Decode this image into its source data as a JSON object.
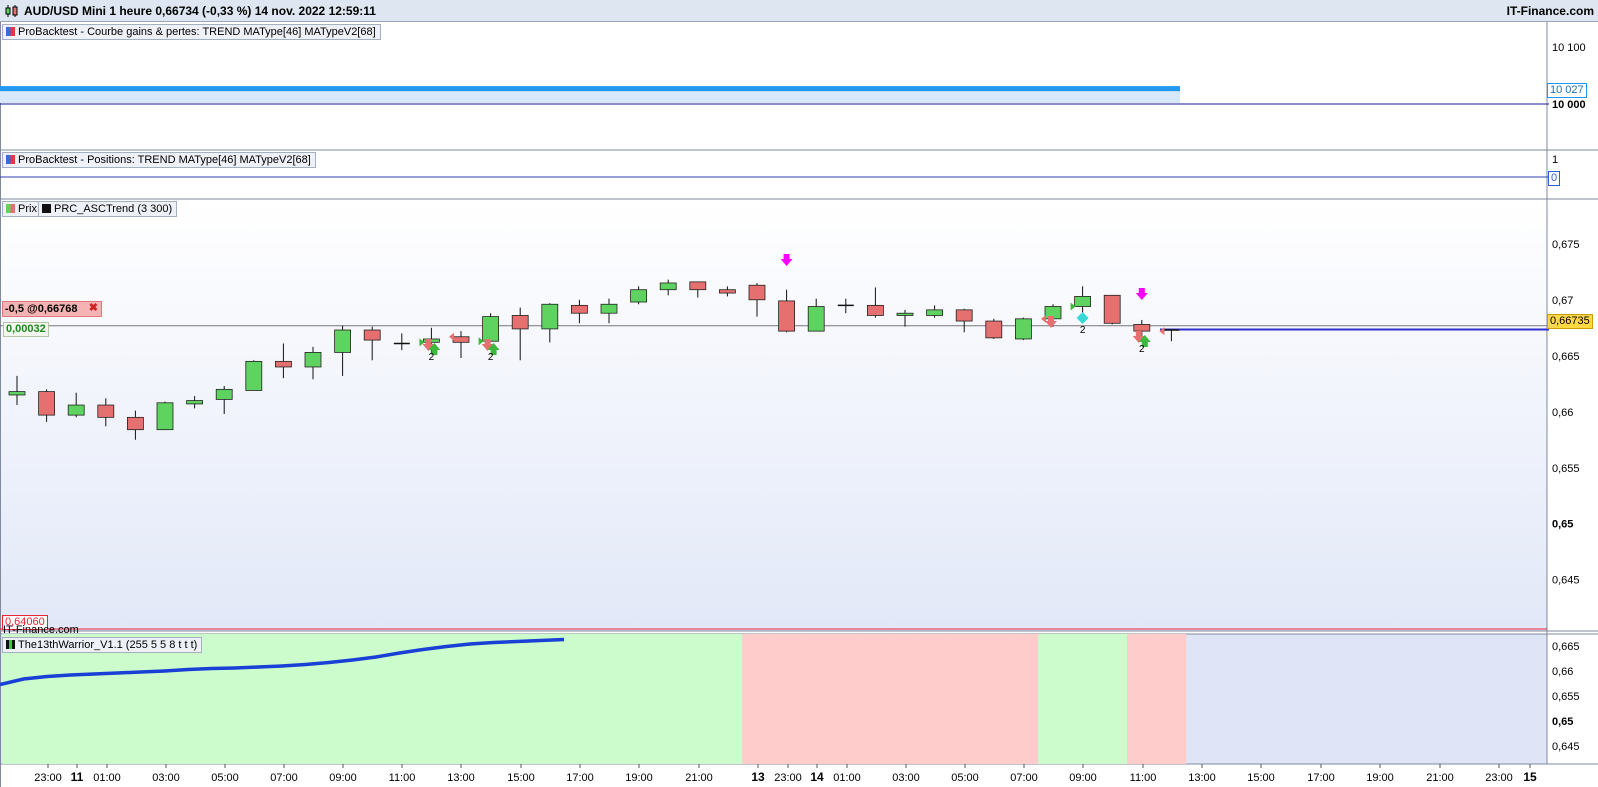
{
  "header": {
    "title": "AUD/USD Mini 1 heure 0,66734 (-0,33 %) 14 nov. 2022 12:59:11",
    "brand": "IT-Finance.com",
    "logo_icon": "candlestick-icon"
  },
  "panels": {
    "equity": {
      "label": "ProBacktest - Courbe gains & pertes: TREND MAType[46] MATypeV2[68]",
      "y_ticks": [
        "10 100",
        "10 000"
      ],
      "last_value_tag": "10 027",
      "baseline": 10000,
      "equity_value": 10027,
      "line_color": "#2196f3"
    },
    "positions": {
      "label": "ProBacktest - Positions: TREND MAType[46] MATypeV2[68]",
      "y_ticks": [
        "1"
      ],
      "last_value_tag": "0"
    },
    "price": {
      "legend_prix": "Prix",
      "legend_indicator": "PRC_ASCTrend (3 300)",
      "y_ticks": [
        "0,675",
        "0,67",
        "0,665",
        "0,66",
        "0,655",
        "0,65",
        "0,645"
      ],
      "position_label": "-0,5 @0,66768",
      "pnl_label": "0,00032",
      "close_icon": "close-icon",
      "low_label": "0,64060",
      "watermark": "IT-Finance.com",
      "current_price_tag": "0,66735",
      "signal_count_label": "2",
      "up_color": "#5fd35f",
      "down_color": "#e66f6f",
      "signal_color": "#ff00ff"
    },
    "warrior": {
      "label": "The13thWarrior_V1.1 (255 5 5 8 t t t)",
      "y_ticks": [
        "0,665",
        "0,66",
        "0,655",
        "0,65",
        "0,645"
      ],
      "line_color": "#1a3fd6",
      "bull_color": "#ccfccc",
      "bear_color": "#ffcccc"
    }
  },
  "x_axis": {
    "labels": [
      "23:00",
      "11",
      "01:00",
      "03:00",
      "05:00",
      "07:00",
      "09:00",
      "11:00",
      "13:00",
      "15:00",
      "17:00",
      "19:00",
      "21:00",
      "13",
      "23:00",
      "14",
      "01:00",
      "03:00",
      "05:00",
      "07:00",
      "09:00",
      "11:00",
      "13:00",
      "15:00",
      "17:00",
      "19:00",
      "21:00",
      "23:00",
      "15"
    ]
  },
  "chart_data": {
    "type": "candlestick",
    "title": "AUD/USD Mini 1 heure",
    "ylim": [
      0.6406,
      0.679
    ],
    "candles": [
      {
        "t": "22:00",
        "o": 0.6615,
        "h": 0.6632,
        "l": 0.6606,
        "c": 0.6618
      },
      {
        "t": "23:00",
        "o": 0.6618,
        "h": 0.662,
        "l": 0.6591,
        "c": 0.6597
      },
      {
        "t": "00:00",
        "o": 0.6597,
        "h": 0.6617,
        "l": 0.6595,
        "c": 0.6606
      },
      {
        "t": "01:00",
        "o": 0.6606,
        "h": 0.6612,
        "l": 0.6587,
        "c": 0.6595
      },
      {
        "t": "02:00",
        "o": 0.6595,
        "h": 0.6601,
        "l": 0.6575,
        "c": 0.6584
      },
      {
        "t": "03:00",
        "o": 0.6584,
        "h": 0.6609,
        "l": 0.6584,
        "c": 0.6608
      },
      {
        "t": "04:00",
        "o": 0.6607,
        "h": 0.6614,
        "l": 0.6603,
        "c": 0.661
      },
      {
        "t": "05:00",
        "o": 0.6611,
        "h": 0.6623,
        "l": 0.6598,
        "c": 0.662
      },
      {
        "t": "06:00",
        "o": 0.6619,
        "h": 0.6646,
        "l": 0.6619,
        "c": 0.6645
      },
      {
        "t": "07:00",
        "o": 0.6645,
        "h": 0.6661,
        "l": 0.663,
        "c": 0.664
      },
      {
        "t": "08:00",
        "o": 0.664,
        "h": 0.6658,
        "l": 0.6629,
        "c": 0.6653
      },
      {
        "t": "09:00",
        "o": 0.6653,
        "h": 0.6677,
        "l": 0.6632,
        "c": 0.6673
      },
      {
        "t": "10:00",
        "o": 0.6673,
        "h": 0.6676,
        "l": 0.6646,
        "c": 0.6664
      },
      {
        "t": "11:00",
        "o": 0.6661,
        "h": 0.667,
        "l": 0.6655,
        "c": 0.6661
      },
      {
        "t": "12:00",
        "o": 0.6662,
        "h": 0.6675,
        "l": 0.6652,
        "c": 0.6665
      },
      {
        "t": "13:00",
        "o": 0.6667,
        "h": 0.6672,
        "l": 0.6648,
        "c": 0.6662
      },
      {
        "t": "14:00",
        "o": 0.6663,
        "h": 0.6688,
        "l": 0.6663,
        "c": 0.6685
      },
      {
        "t": "15:00",
        "o": 0.6686,
        "h": 0.6693,
        "l": 0.6646,
        "c": 0.6674
      },
      {
        "t": "16:00",
        "o": 0.6674,
        "h": 0.6697,
        "l": 0.6662,
        "c": 0.6696
      },
      {
        "t": "17:00",
        "o": 0.6695,
        "h": 0.67,
        "l": 0.6679,
        "c": 0.6688
      },
      {
        "t": "18:00",
        "o": 0.6688,
        "h": 0.6701,
        "l": 0.6679,
        "c": 0.6696
      },
      {
        "t": "19:00",
        "o": 0.6698,
        "h": 0.6712,
        "l": 0.6696,
        "c": 0.6709
      },
      {
        "t": "20:00",
        "o": 0.6709,
        "h": 0.6718,
        "l": 0.6704,
        "c": 0.6715
      },
      {
        "t": "21:00",
        "o": 0.6716,
        "h": 0.6716,
        "l": 0.6702,
        "c": 0.6709
      },
      {
        "t": "22:00",
        "o": 0.6709,
        "h": 0.6712,
        "l": 0.6703,
        "c": 0.6706
      },
      {
        "t": "22:00",
        "o": 0.6713,
        "h": 0.6715,
        "l": 0.6685,
        "c": 0.67
      },
      {
        "t": "23:00",
        "o": 0.6699,
        "h": 0.6709,
        "l": 0.6671,
        "c": 0.6672
      },
      {
        "t": "00:00",
        "o": 0.6672,
        "h": 0.6701,
        "l": 0.6672,
        "c": 0.6694
      },
      {
        "t": "01:00",
        "o": 0.6695,
        "h": 0.6701,
        "l": 0.6688,
        "c": 0.6695
      },
      {
        "t": "02:00",
        "o": 0.6695,
        "h": 0.6711,
        "l": 0.6684,
        "c": 0.6686
      },
      {
        "t": "03:00",
        "o": 0.6686,
        "h": 0.6691,
        "l": 0.6676,
        "c": 0.6688
      },
      {
        "t": "04:00",
        "o": 0.6686,
        "h": 0.6695,
        "l": 0.6684,
        "c": 0.6691
      },
      {
        "t": "05:00",
        "o": 0.6691,
        "h": 0.6692,
        "l": 0.6671,
        "c": 0.6681
      },
      {
        "t": "06:00",
        "o": 0.6681,
        "h": 0.6683,
        "l": 0.6665,
        "c": 0.6666
      },
      {
        "t": "07:00",
        "o": 0.6665,
        "h": 0.6684,
        "l": 0.6664,
        "c": 0.6683
      },
      {
        "t": "08:00",
        "o": 0.6683,
        "h": 0.6696,
        "l": 0.6676,
        "c": 0.6694
      },
      {
        "t": "09:00",
        "o": 0.6694,
        "h": 0.6712,
        "l": 0.6684,
        "c": 0.6703
      },
      {
        "t": "10:00",
        "o": 0.6704,
        "h": 0.6704,
        "l": 0.6678,
        "c": 0.6679
      },
      {
        "t": "11:00",
        "o": 0.6678,
        "h": 0.6682,
        "l": 0.6666,
        "c": 0.6672
      },
      {
        "t": "12:00",
        "o": 0.6672,
        "h": 0.6673,
        "l": 0.6663,
        "c": 0.6673
      }
    ],
    "equity_curve": {
      "baseline": 10000,
      "value": 10027
    },
    "current_price": 0.66735,
    "warrior_line": [
      0.6573,
      0.6584,
      0.6589,
      0.6592,
      0.6594,
      0.6596,
      0.6598,
      0.66,
      0.6603,
      0.6605,
      0.6606,
      0.6608,
      0.661,
      0.6613,
      0.6617,
      0.6622,
      0.6628,
      0.6636,
      0.6643,
      0.6649,
      0.6654,
      0.6657,
      0.6659,
      0.6661,
      0.6663
    ],
    "warrior_zones": [
      "bull",
      "bull",
      "bull",
      "bull",
      "bull",
      "bull",
      "bull",
      "bull",
      "bull",
      "bull",
      "bull",
      "bull",
      "bull",
      "bull",
      "bull",
      "bull",
      "bull",
      "bull",
      "bull",
      "bull",
      "bull",
      "bull",
      "bull",
      "bull",
      "bull",
      "bear",
      "bear",
      "bear",
      "bear",
      "bear",
      "bear",
      "bear",
      "bear",
      "bear",
      "bear",
      "bull",
      "bull",
      "bull",
      "bear",
      "bear"
    ]
  }
}
